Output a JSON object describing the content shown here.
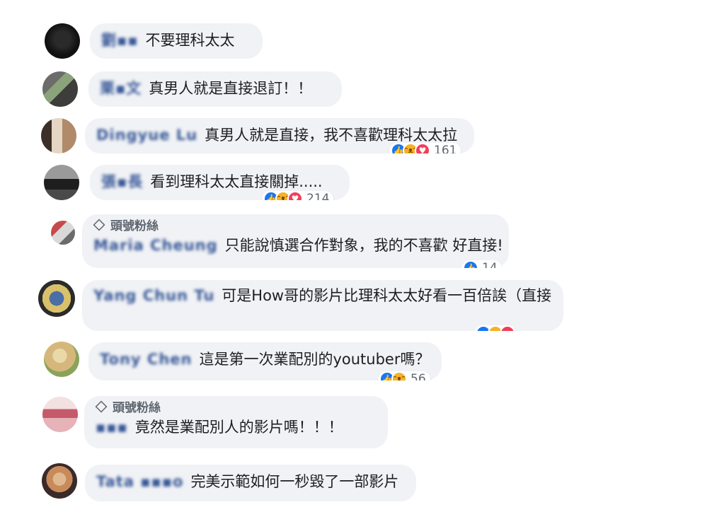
{
  "comments": [
    {
      "name": "劉▪▪",
      "text": "不要理科太太",
      "avatar_colors": [
        "#141414",
        "#2a2a2a",
        "#0b0b0b"
      ]
    },
    {
      "name": "栗▪文",
      "text": "真男人就是直接退訂！！",
      "avatar_colors": [
        "#5a5a58",
        "#8ba37a",
        "#3d3d3b"
      ]
    },
    {
      "name": "Dingyue Lu",
      "text": "真男人就是直接，我不喜歡理科太太拉",
      "avatar_colors": [
        "#b08a6a",
        "#3b2f27",
        "#e5d6c4"
      ],
      "reaction_count": "161"
    },
    {
      "name": "張▪長",
      "text": "看到理科太太直接關掉.....",
      "avatar_colors": [
        "#4a4a4a",
        "#9a9a9a",
        "#1e1e1e"
      ],
      "reaction_count": "214"
    },
    {
      "badge": "頭號粉絲",
      "name": "Maria Cheung",
      "text": "只能說慎選合作對象，我的不喜歡 好直接!",
      "avatar_colors": [
        "#c64a4a",
        "#d9d9d9",
        "#6b6b6b"
      ],
      "reaction_count": "14"
    },
    {
      "name": "Yang Chun Tu",
      "text": "可是How哥的影片比理科太太好看一百倍誒（直接",
      "avatar_colors": [
        "#d9c06a",
        "#4a6ea6",
        "#2b2b2b"
      ]
    },
    {
      "name": "Tony Chen",
      "text": "這是第一次業配別的youtuber嗎？",
      "avatar_colors": [
        "#d6b77b",
        "#8aa35a",
        "#e9d8a8"
      ],
      "reaction_count": "56"
    },
    {
      "badge": "頭號粉絲",
      "name": "▪▪▪",
      "text": "竟然是業配別人的影片嗎！！！",
      "avatar_colors": [
        "#e6b3b8",
        "#c55a6a",
        "#f3e0e0"
      ]
    },
    {
      "name": "Tata ▪▪▪o",
      "text": "完美示範如何一秒毀了一部影片",
      "avatar_colors": [
        "#c98a5a",
        "#3a2a2a",
        "#e0b890"
      ]
    }
  ]
}
